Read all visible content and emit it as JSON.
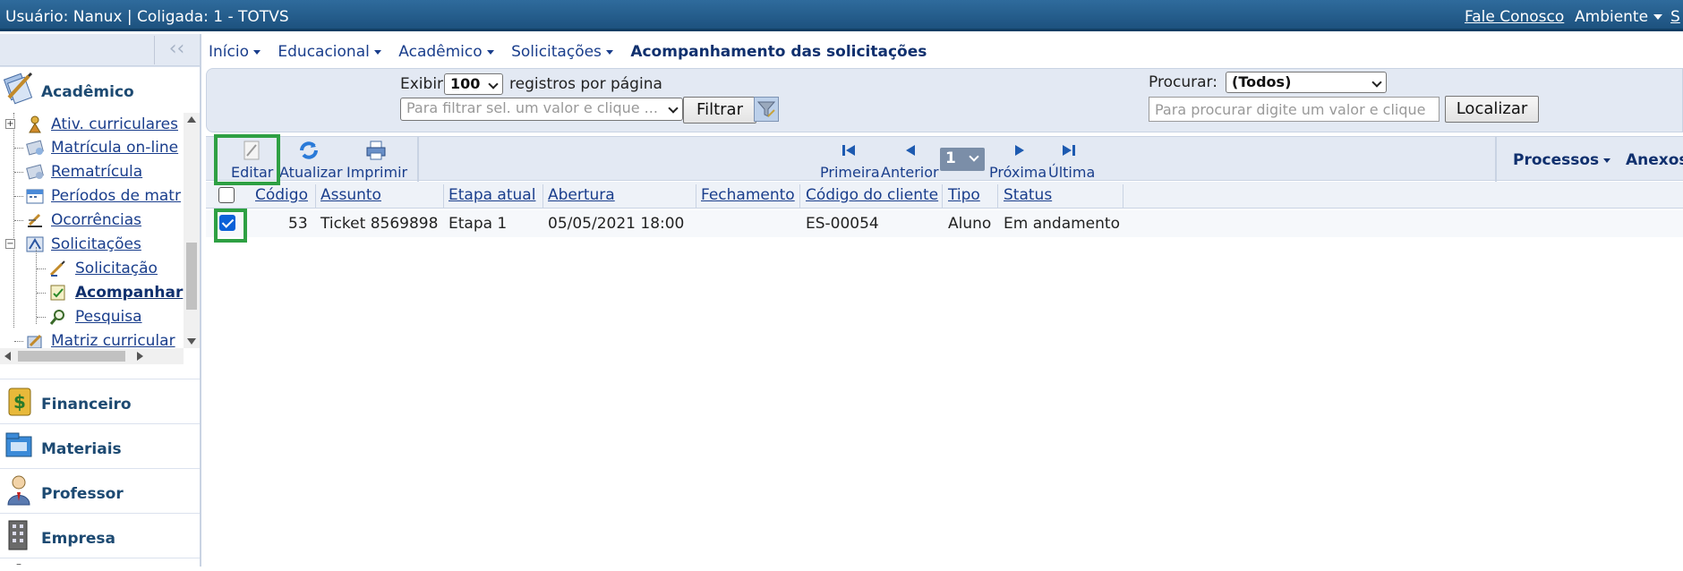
{
  "topbar": {
    "user_text": "Usuário: Nanux  |  Coligada: 1 - TOTVS",
    "contact_link": "Fale Conosco",
    "ambiente": "Ambiente",
    "trailing": "S"
  },
  "sidebar": {
    "collapse_glyph": "‹‹",
    "modules": [
      {
        "label": "Acadêmico",
        "icon": "academic-icon"
      },
      {
        "label": "Financeiro",
        "icon": "money-icon"
      },
      {
        "label": "Materiais",
        "icon": "materials-icon"
      },
      {
        "label": "Professor",
        "icon": "professor-icon"
      },
      {
        "label": "Empresa",
        "icon": "building-icon"
      }
    ],
    "tree": [
      {
        "label": "Ativ. curriculares"
      },
      {
        "label": "Matrícula on-line"
      },
      {
        "label": "Rematrícula"
      },
      {
        "label": "Períodos de matr"
      },
      {
        "label": "Ocorrências"
      },
      {
        "label": "Solicitações"
      },
      {
        "label": "Solicitação"
      },
      {
        "label": "Acompanhar"
      },
      {
        "label": "Pesquisa"
      },
      {
        "label": "Matriz curricular"
      }
    ]
  },
  "breadcrumb": {
    "items": [
      "Início",
      "Educacional",
      "Acadêmico",
      "Solicitações"
    ],
    "current": "Acompanhamento das solicitações"
  },
  "filter": {
    "show_label": "Exibir",
    "page_size": "100",
    "per_page_label": "registros por página",
    "filter_placeholder": "Para filtrar sel. um valor e clique ...",
    "filter_button": "Filtrar",
    "search_label": "Procurar:",
    "search_scope": "(Todos)",
    "search_placeholder": "Para procurar digite um valor e clique",
    "search_button": "Localizar"
  },
  "toolbar": {
    "edit": "Editar",
    "refresh": "Atualizar",
    "print": "Imprimir",
    "first": "Primeira",
    "previous": "Anterior",
    "page": "1",
    "next": "Próxima",
    "last": "Última",
    "processes": "Processos",
    "attachments": "Anexos"
  },
  "grid": {
    "columns": [
      "Código",
      "Assunto",
      "Etapa atual",
      "Abertura",
      "Fechamento",
      "Código do cliente",
      "Tipo",
      "Status"
    ],
    "rows": [
      {
        "selected": true,
        "codigo": "53",
        "assunto": "Ticket 8569898",
        "etapa": "Etapa 1",
        "abertura": "05/05/2021 18:00",
        "fechamento": "",
        "cliente": "ES-00054",
        "tipo": "Aluno",
        "status": "Em andamento"
      }
    ]
  },
  "colors": {
    "topbar": "#1d527f",
    "panel": "#e3e9f3",
    "link": "#1a3e8c",
    "highlight": "#2ea043",
    "checkbox": "#0b61d8"
  }
}
